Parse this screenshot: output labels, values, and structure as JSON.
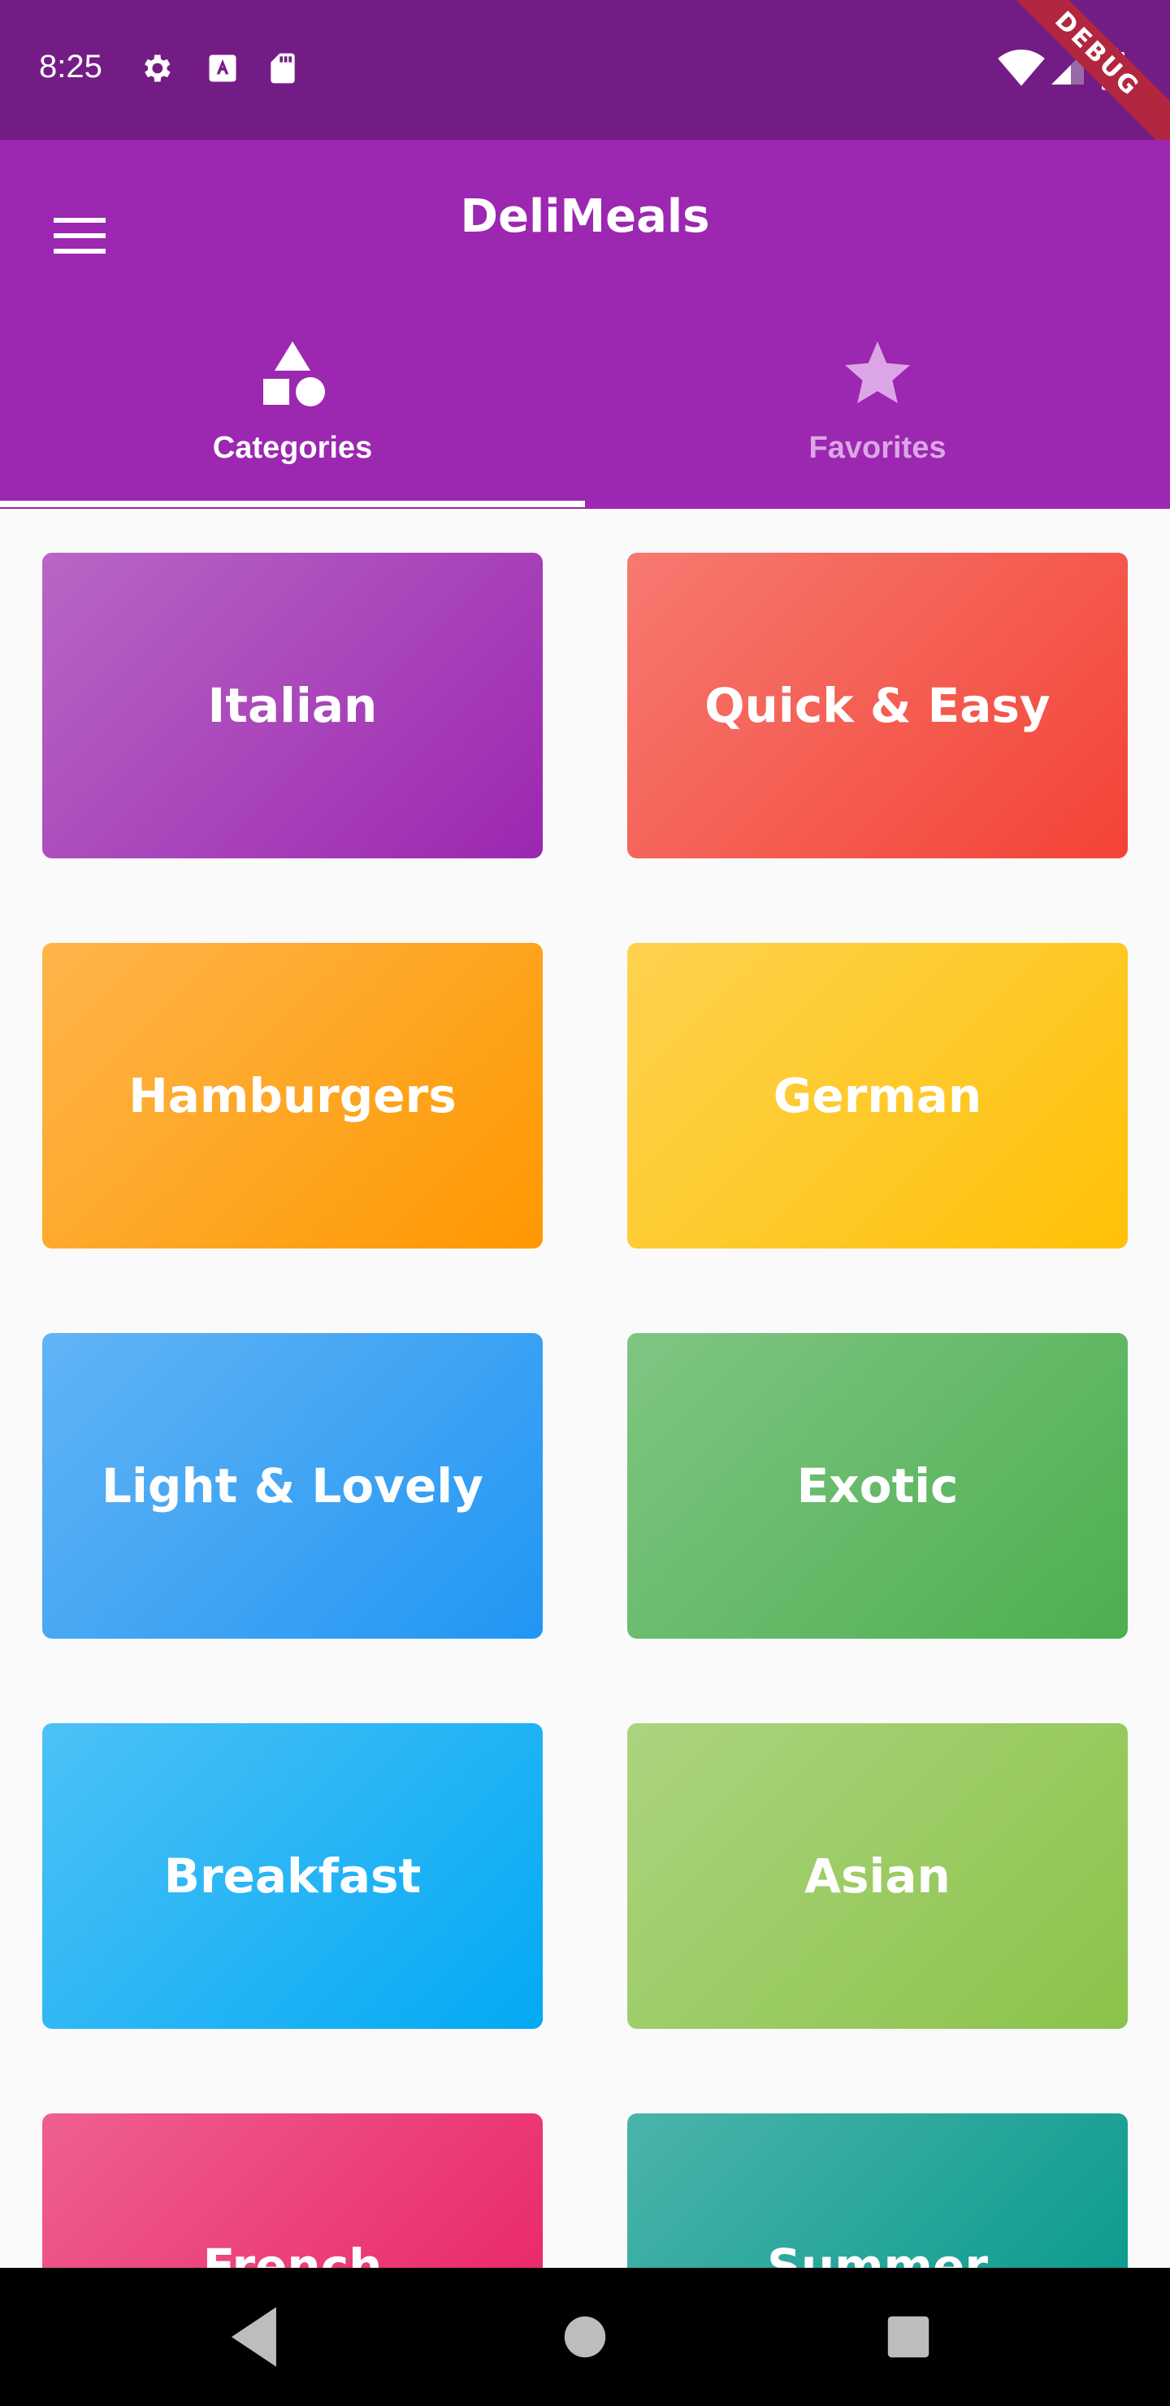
{
  "status_bar": {
    "time": "8:25",
    "left_icons": [
      "gear-icon",
      "text-a-icon",
      "sd-card-icon"
    ],
    "right_icons": [
      "wifi-icon",
      "signal-icon",
      "battery-icon"
    ],
    "debug_banner": "DEBUG",
    "color": "#741c85"
  },
  "app_bar": {
    "title": "DeliMeals",
    "menu_icon": "hamburger-menu-icon",
    "color": "#9c27b0"
  },
  "tabs": [
    {
      "label": "Categories",
      "icon": "category-shapes-icon",
      "selected": true
    },
    {
      "label": "Favorites",
      "icon": "star-icon",
      "selected": false
    }
  ],
  "categories": [
    {
      "title": "Italian",
      "color": "#9c27b0"
    },
    {
      "title": "Quick & Easy",
      "color": "#f44336"
    },
    {
      "title": "Hamburgers",
      "color": "#ff9800"
    },
    {
      "title": "German",
      "color": "#ffc107"
    },
    {
      "title": "Light & Lovely",
      "color": "#2196f3"
    },
    {
      "title": "Exotic",
      "color": "#4caf50"
    },
    {
      "title": "Breakfast",
      "color": "#03a9f4"
    },
    {
      "title": "Asian",
      "color": "#8bc34a"
    },
    {
      "title": "French",
      "color": "#e91e63"
    },
    {
      "title": "Summer",
      "color": "#009688"
    }
  ],
  "nav_bar": {
    "buttons": [
      "back-icon",
      "home-icon",
      "recents-icon"
    ]
  }
}
